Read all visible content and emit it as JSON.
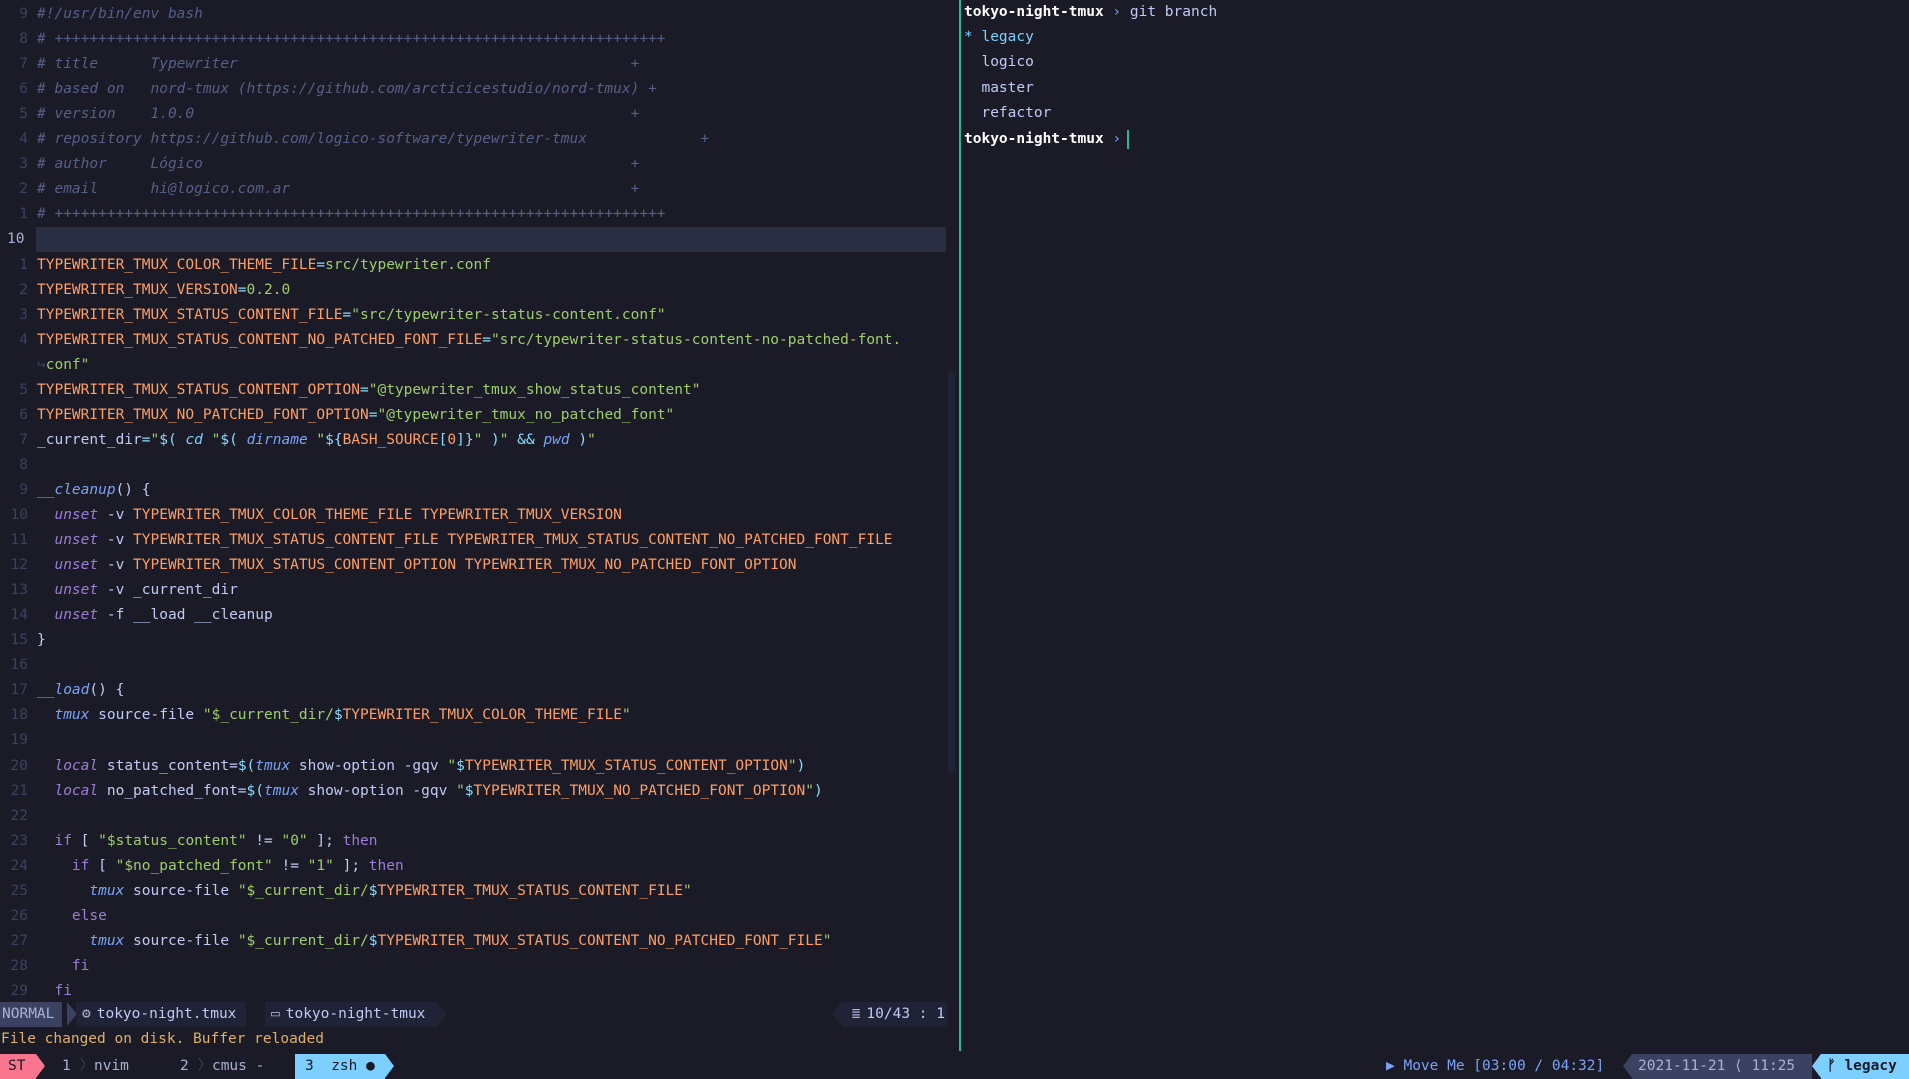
{
  "editor": {
    "lines": [
      {
        "num": "9",
        "code": [
          [
            "cm",
            "#!/usr/bin/env bash"
          ]
        ]
      },
      {
        "num": "8",
        "code": [
          [
            "cm",
            "# ++++++++++++++++++++++++++++++++++++++++++++++++++++++++++++++++++++++"
          ]
        ]
      },
      {
        "num": "7",
        "code": [
          [
            "cm",
            "# title      Typewriter                                             +"
          ]
        ]
      },
      {
        "num": "6",
        "code": [
          [
            "cm",
            "# based on   nord-tmux (https://github.com/arcticicestudio/nord-tmux) +"
          ]
        ]
      },
      {
        "num": "5",
        "code": [
          [
            "cm",
            "# version    1.0.0                                                  +"
          ]
        ]
      },
      {
        "num": "4",
        "code": [
          [
            "cm",
            "# repository https://github.com/logico-software/typewriter-tmux             +"
          ]
        ]
      },
      {
        "num": "3",
        "code": [
          [
            "cm",
            "# author     Lógico                                                 +"
          ]
        ]
      },
      {
        "num": "2",
        "code": [
          [
            "cm",
            "# email      hi@logico.com.ar                                       +"
          ]
        ]
      },
      {
        "num": "1",
        "code": [
          [
            "cm",
            "# ++++++++++++++++++++++++++++++++++++++++++++++++++++++++++++++++++++++"
          ]
        ]
      },
      {
        "num": "10",
        "cur": true,
        "code": []
      },
      {
        "num": "1",
        "code": [
          [
            "var",
            "TYPEWRITER_TMUX_COLOR_THEME_FILE"
          ],
          [
            "op",
            "="
          ],
          [
            "str",
            "src/typewriter.conf"
          ]
        ]
      },
      {
        "num": "2",
        "code": [
          [
            "var",
            "TYPEWRITER_TMUX_VERSION"
          ],
          [
            "op",
            "="
          ],
          [
            "str",
            "0.2.0"
          ]
        ]
      },
      {
        "num": "3",
        "code": [
          [
            "var",
            "TYPEWRITER_TMUX_STATUS_CONTENT_FILE"
          ],
          [
            "op",
            "="
          ],
          [
            "str",
            "\"src/typewriter-status-content.conf\""
          ]
        ]
      },
      {
        "num": "4",
        "code": [
          [
            "var",
            "TYPEWRITER_TMUX_STATUS_CONTENT_NO_PATCHED_FONT_FILE"
          ],
          [
            "op",
            "="
          ],
          [
            "str",
            "\"src/typewriter-status-content-no-patched-font."
          ]
        ]
      },
      {
        "num": "",
        "code": [
          [
            "wrap",
            "↪"
          ],
          [
            "str",
            "conf\""
          ]
        ]
      },
      {
        "num": "5",
        "code": [
          [
            "var",
            "TYPEWRITER_TMUX_STATUS_CONTENT_OPTION"
          ],
          [
            "op",
            "="
          ],
          [
            "str",
            "\"@typewriter_tmux_show_status_content\""
          ]
        ]
      },
      {
        "num": "6",
        "code": [
          [
            "var",
            "TYPEWRITER_TMUX_NO_PATCHED_FONT_OPTION"
          ],
          [
            "op",
            "="
          ],
          [
            "str",
            "\"@typewriter_tmux_no_patched_font\""
          ]
        ]
      },
      {
        "num": "7",
        "code": [
          [
            "plain",
            "_current_dir"
          ],
          [
            "op",
            "="
          ],
          [
            "str",
            "\""
          ],
          [
            "op",
            "$( "
          ],
          [
            "cmd",
            "cd"
          ],
          [
            "str",
            " \""
          ],
          [
            "op",
            "$( "
          ],
          [
            "fn",
            "dirname"
          ],
          [
            "str",
            " \""
          ],
          [
            "op",
            "${"
          ],
          [
            "var",
            "BASH_SOURCE"
          ],
          [
            "op",
            "["
          ],
          [
            "var",
            "0"
          ],
          [
            "op",
            "]}"
          ],
          [
            "str",
            "\""
          ],
          [
            "op",
            " )"
          ],
          [
            "str",
            "\""
          ],
          [
            "op",
            " && "
          ],
          [
            "fn",
            "pwd"
          ],
          [
            "op",
            " )"
          ],
          [
            "str",
            "\""
          ]
        ]
      },
      {
        "num": "8",
        "code": []
      },
      {
        "num": "9",
        "code": [
          [
            "fn",
            "__cleanup"
          ],
          [
            "plain",
            "() {"
          ]
        ]
      },
      {
        "num": "10",
        "code": [
          [
            "plain",
            "  "
          ],
          [
            "kw",
            "unset"
          ],
          [
            "plain",
            " -v "
          ],
          [
            "var",
            "TYPEWRITER_TMUX_COLOR_THEME_FILE TYPEWRITER_TMUX_VERSION"
          ]
        ]
      },
      {
        "num": "11",
        "code": [
          [
            "plain",
            "  "
          ],
          [
            "kw",
            "unset"
          ],
          [
            "plain",
            " -v "
          ],
          [
            "var",
            "TYPEWRITER_TMUX_STATUS_CONTENT_FILE TYPEWRITER_TMUX_STATUS_CONTENT_NO_PATCHED_FONT_FILE"
          ]
        ]
      },
      {
        "num": "12",
        "code": [
          [
            "plain",
            "  "
          ],
          [
            "kw",
            "unset"
          ],
          [
            "plain",
            " -v "
          ],
          [
            "var",
            "TYPEWRITER_TMUX_STATUS_CONTENT_OPTION TYPEWRITER_TMUX_NO_PATCHED_FONT_OPTION"
          ]
        ]
      },
      {
        "num": "13",
        "code": [
          [
            "plain",
            "  "
          ],
          [
            "kw",
            "unset"
          ],
          [
            "plain",
            " -v _current_dir"
          ]
        ]
      },
      {
        "num": "14",
        "code": [
          [
            "plain",
            "  "
          ],
          [
            "kw",
            "unset"
          ],
          [
            "plain",
            " -f __load __cleanup"
          ]
        ]
      },
      {
        "num": "15",
        "code": [
          [
            "plain",
            "}"
          ]
        ]
      },
      {
        "num": "16",
        "code": []
      },
      {
        "num": "17",
        "code": [
          [
            "fn",
            "__load"
          ],
          [
            "plain",
            "() {"
          ]
        ]
      },
      {
        "num": "18",
        "code": [
          [
            "plain",
            "  "
          ],
          [
            "fn",
            "tmux"
          ],
          [
            "plain",
            " source-file "
          ],
          [
            "str",
            "\"$_current_dir/"
          ],
          [
            "op",
            "$"
          ],
          [
            "var",
            "TYPEWRITER_TMUX_COLOR_THEME_FILE"
          ],
          [
            "str",
            "\""
          ]
        ]
      },
      {
        "num": "19",
        "code": []
      },
      {
        "num": "20",
        "code": [
          [
            "plain",
            "  "
          ],
          [
            "kw",
            "local"
          ],
          [
            "plain",
            " status_content="
          ],
          [
            "op",
            "$("
          ],
          [
            "fn",
            "tmux"
          ],
          [
            "plain",
            " show-option -gqv "
          ],
          [
            "str",
            "\""
          ],
          [
            "op",
            "$"
          ],
          [
            "var",
            "TYPEWRITER_TMUX_STATUS_CONTENT_OPTION"
          ],
          [
            "str",
            "\""
          ],
          [
            "op",
            ")"
          ]
        ]
      },
      {
        "num": "21",
        "code": [
          [
            "plain",
            "  "
          ],
          [
            "kw",
            "local"
          ],
          [
            "plain",
            " no_patched_font="
          ],
          [
            "op",
            "$("
          ],
          [
            "fn",
            "tmux"
          ],
          [
            "plain",
            " show-option -gqv "
          ],
          [
            "str",
            "\""
          ],
          [
            "op",
            "$"
          ],
          [
            "var",
            "TYPEWRITER_TMUX_NO_PATCHED_FONT_OPTION"
          ],
          [
            "str",
            "\""
          ],
          [
            "op",
            ")"
          ]
        ]
      },
      {
        "num": "22",
        "code": []
      },
      {
        "num": "23",
        "code": [
          [
            "plain",
            "  "
          ],
          [
            "kw2",
            "if"
          ],
          [
            "plain",
            " [ "
          ],
          [
            "str",
            "\"$status_content\""
          ],
          [
            "plain",
            " != "
          ],
          [
            "str",
            "\"0\""
          ],
          [
            "plain",
            " ]; "
          ],
          [
            "kw2",
            "then"
          ]
        ]
      },
      {
        "num": "24",
        "code": [
          [
            "plain",
            "    "
          ],
          [
            "kw2",
            "if"
          ],
          [
            "plain",
            " [ "
          ],
          [
            "str",
            "\"$no_patched_font\""
          ],
          [
            "plain",
            " != "
          ],
          [
            "str",
            "\"1\""
          ],
          [
            "plain",
            " ]; "
          ],
          [
            "kw2",
            "then"
          ]
        ]
      },
      {
        "num": "25",
        "code": [
          [
            "plain",
            "      "
          ],
          [
            "fn",
            "tmux"
          ],
          [
            "plain",
            " source-file "
          ],
          [
            "str",
            "\"$_current_dir/"
          ],
          [
            "op",
            "$"
          ],
          [
            "var",
            "TYPEWRITER_TMUX_STATUS_CONTENT_FILE"
          ],
          [
            "str",
            "\""
          ]
        ]
      },
      {
        "num": "26",
        "code": [
          [
            "plain",
            "    "
          ],
          [
            "kw2",
            "else"
          ]
        ]
      },
      {
        "num": "27",
        "code": [
          [
            "plain",
            "      "
          ],
          [
            "fn",
            "tmux"
          ],
          [
            "plain",
            " source-file "
          ],
          [
            "str",
            "\"$_current_dir/"
          ],
          [
            "op",
            "$"
          ],
          [
            "var",
            "TYPEWRITER_TMUX_STATUS_CONTENT_NO_PATCHED_FONT_FILE"
          ],
          [
            "str",
            "\""
          ]
        ]
      },
      {
        "num": "28",
        "code": [
          [
            "plain",
            "    "
          ],
          [
            "kw2",
            "fi"
          ]
        ]
      },
      {
        "num": "29",
        "code": [
          [
            "plain",
            "  "
          ],
          [
            "kw2",
            "fi"
          ]
        ]
      }
    ]
  },
  "statusline": {
    "mode": "NORMAL",
    "file": "tokyo-night.tmux",
    "directory": "tokyo-night-tmux",
    "position": "10/43 : 1",
    "file_icon": "gear-icon",
    "dir_icon": "folder-icon",
    "position_icon": "lines-icon"
  },
  "cmdline": "File changed on disk. Buffer reloaded",
  "terminal": {
    "prompt_dir": "tokyo-night-tmux",
    "prompt_arrow": "›",
    "command": "git branch",
    "branches": [
      {
        "marker": "*",
        "name": "legacy",
        "current": true
      },
      {
        "marker": " ",
        "name": "logico",
        "current": false
      },
      {
        "marker": " ",
        "name": "master",
        "current": false
      },
      {
        "marker": " ",
        "name": "refactor",
        "current": false
      }
    ]
  },
  "tmux": {
    "session": "ST",
    "windows": [
      {
        "index": "1",
        "name": "nvim",
        "flag": ""
      },
      {
        "index": "2",
        "name": "cmus",
        "flag": "-"
      },
      {
        "index": "3",
        "name": "zsh",
        "flag": "●",
        "active": true
      }
    ],
    "music": "▶ Move Me [03:00 / 04:32]",
    "date": "2021-11-21 ⟨ 11:25",
    "branch": "legacy",
    "branch_icon": "git-branch-icon"
  },
  "colors": {
    "background": "#1a1b26",
    "accent": "#7dcfff",
    "divider": "#1abc9c",
    "session": "#f7768e"
  }
}
